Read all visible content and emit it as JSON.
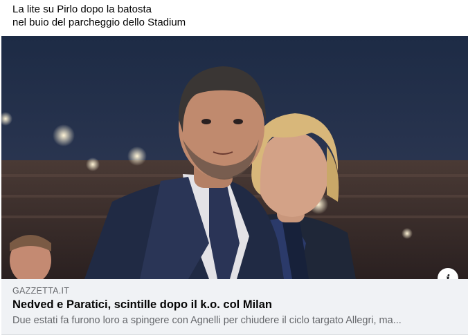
{
  "post": {
    "caption_line1": "La lite su Pirlo dopo la batosta",
    "caption_line2": "nel buio del parcheggio dello Stadium"
  },
  "link_preview": {
    "domain": "GAZZETTA.IT",
    "headline": "Nedved e Paratici, scintille dopo il k.o. col Milan",
    "description": "Due estati fa furono loro a spingere con Agnelli per chiudere il ciclo targato Allegri, ma...",
    "info_icon": "i"
  },
  "colors": {
    "link_bar_bg": "#f0f2f5",
    "secondary_text": "#65676b",
    "primary_text": "#050505"
  },
  "icons": {
    "info": "info-icon"
  }
}
